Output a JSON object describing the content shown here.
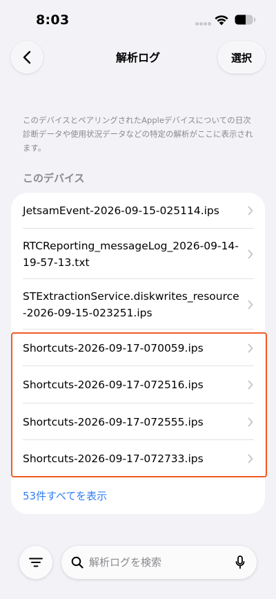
{
  "status_bar": {
    "time": "8:03"
  },
  "nav": {
    "title": "解析ログ",
    "select_label": "選択"
  },
  "description": "このデバイスとペアリングされたAppleデバイスについての日次診断データや使用状況データなどの特定の解析がここに表示されます。",
  "section": {
    "header": "このデバイス"
  },
  "logs": [
    "JetsamEvent-2026-09-15-025114.ips",
    "RTCReporting_messageLog_2026-09-14-19-57-13.txt",
    "STExtractionService.diskwrites_resource-2026-09-15-023251.ips",
    "Shortcuts-2026-09-17-070059.ips",
    "Shortcuts-2026-09-17-072516.ips",
    "Shortcuts-2026-09-17-072555.ips",
    "Shortcuts-2026-09-17-072733.ips"
  ],
  "show_all_label": "53件すべてを表示",
  "search": {
    "placeholder": "解析ログを検索"
  },
  "colors": {
    "accent": "#2f7cf6",
    "highlight": "#f05a22",
    "background": "#f2f2f7"
  }
}
